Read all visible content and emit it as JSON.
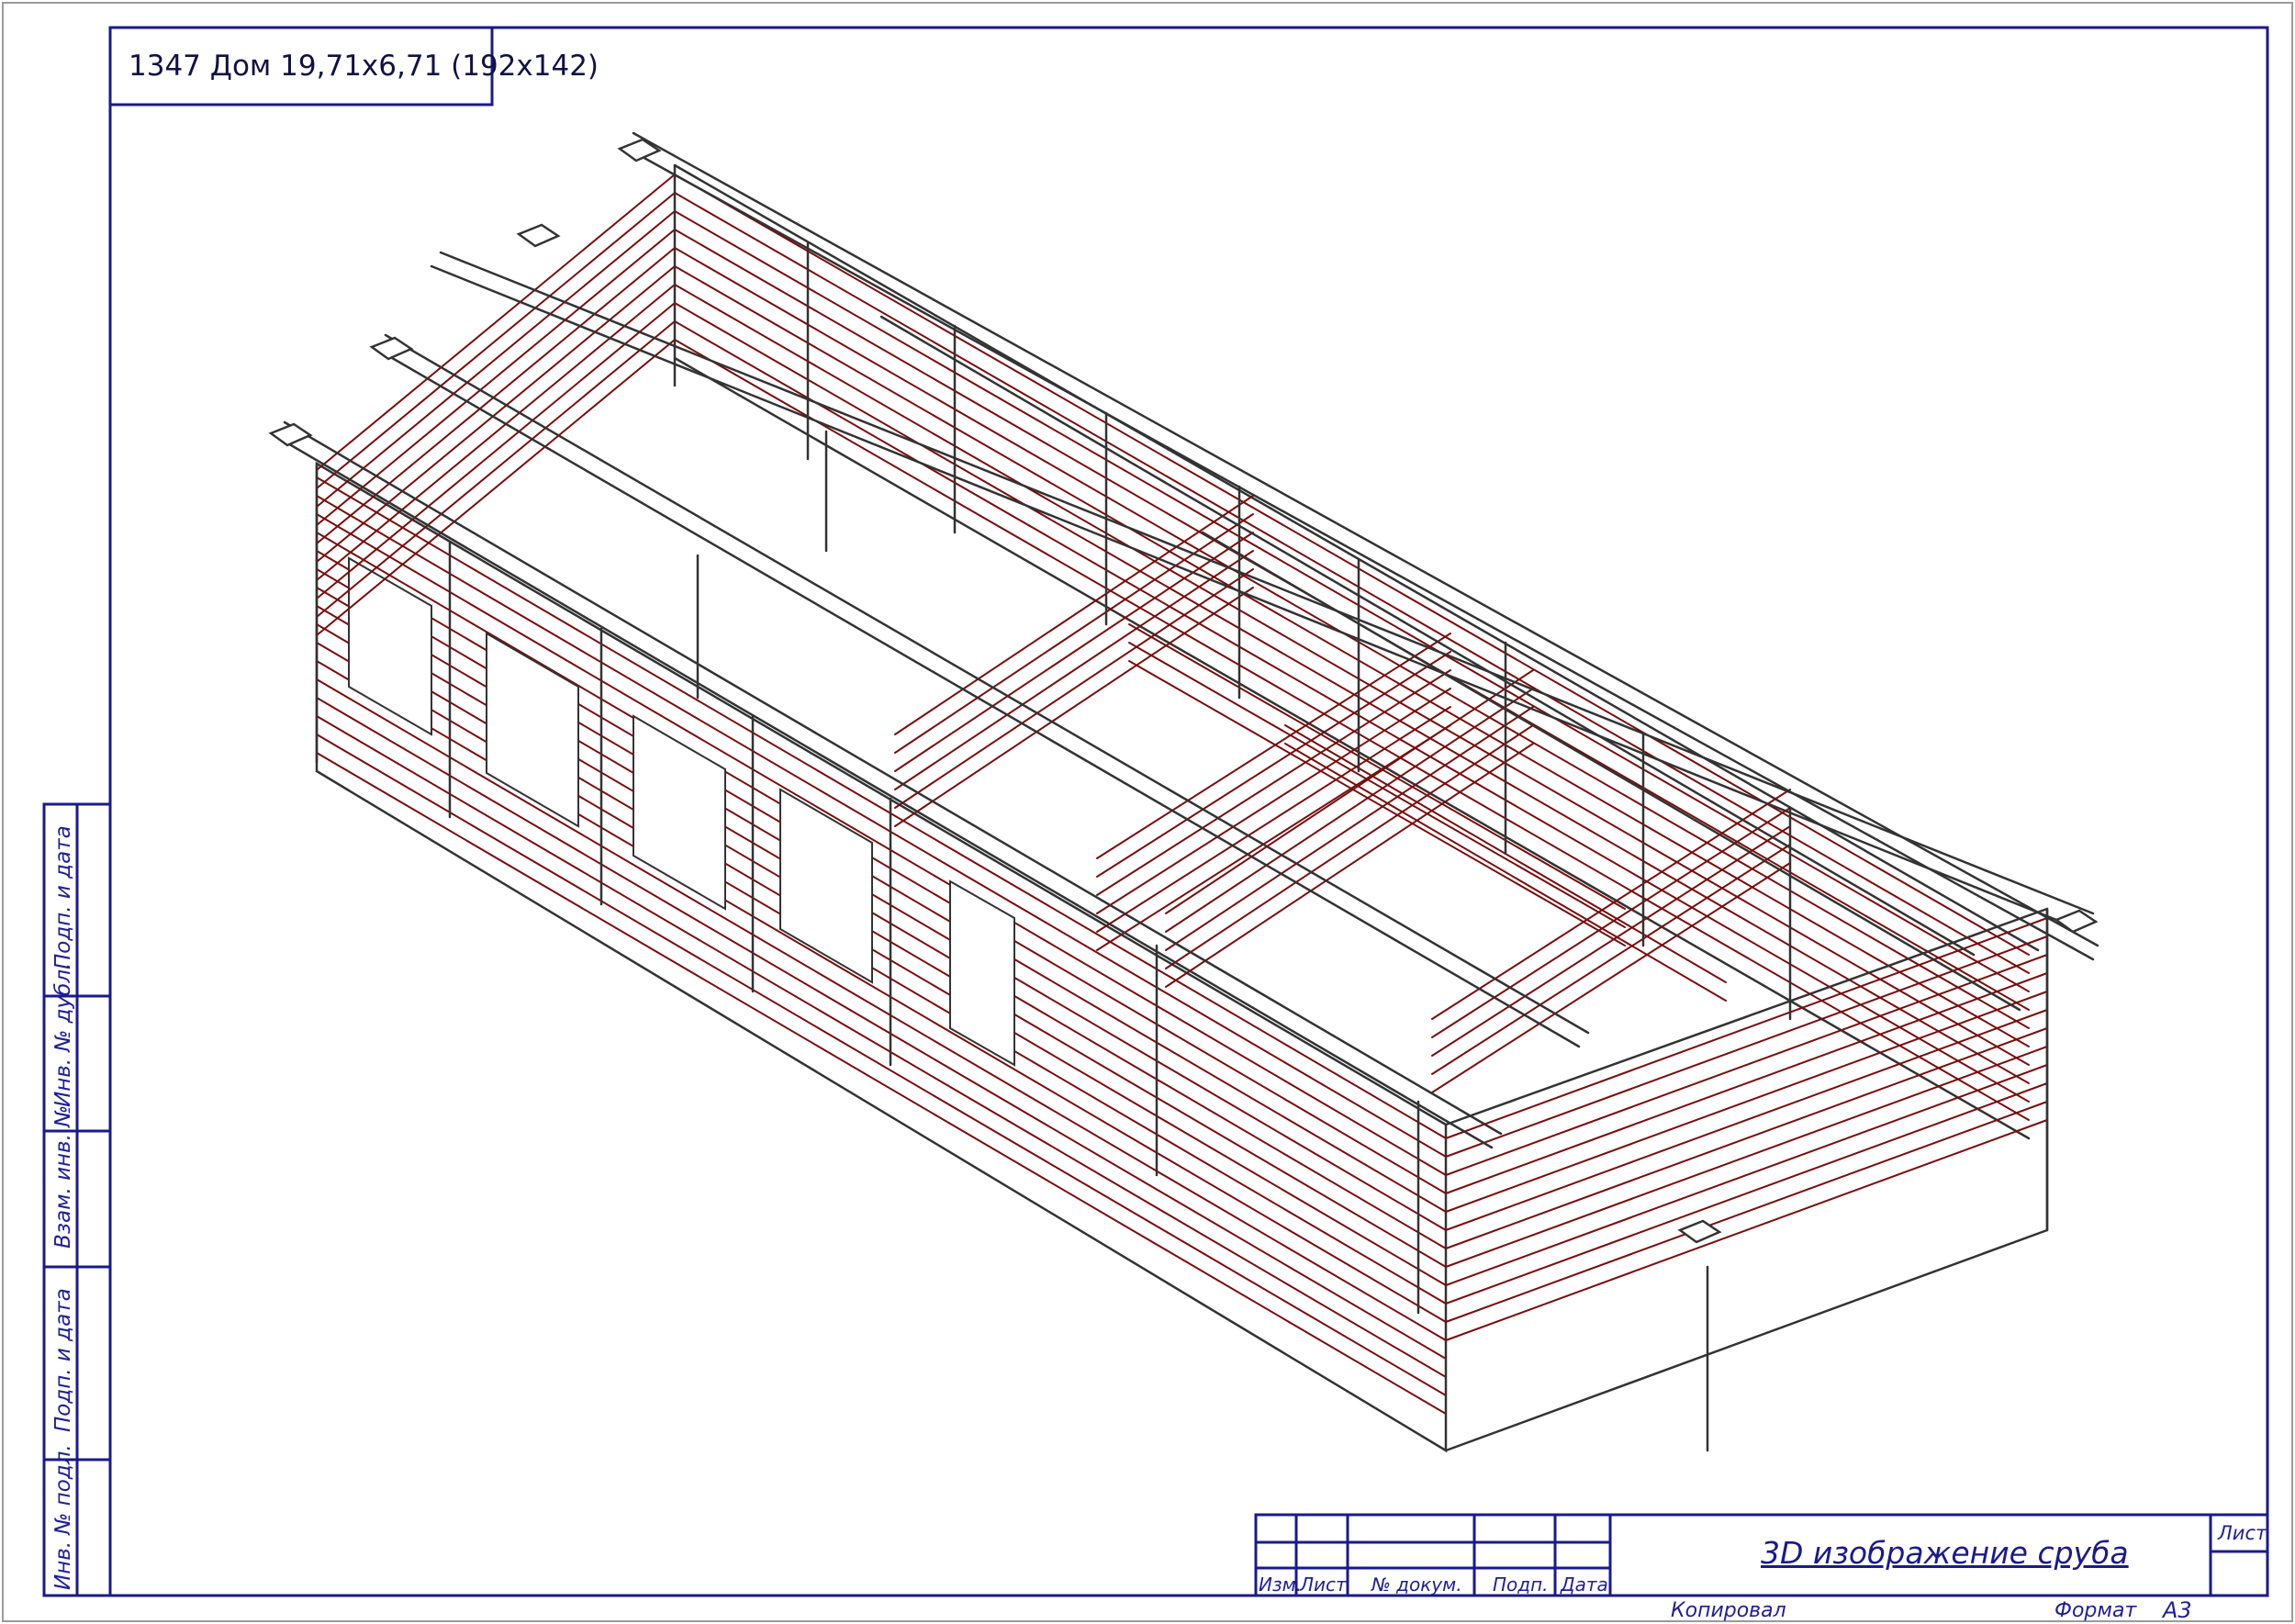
{
  "drawing": {
    "title": "1347 Дом 19,71х6,71 (192х142)"
  },
  "side_stamp": {
    "labels": [
      "Подп. и дата",
      "Инв. № дубл.",
      "Взам. инв. №",
      "Подп. и дата",
      "Инв. № подл."
    ]
  },
  "title_block": {
    "main_title": "3D изображение сруба",
    "sheet_label": "Лист",
    "headers": [
      "Изм.",
      "Лист",
      "№ докум.",
      "Подп.",
      "Дата"
    ],
    "copied_label": "Копировал",
    "format_label": "Формат",
    "format_value": "А3"
  },
  "colors": {
    "frame": "#1a1a8c",
    "model_lines": "#7a0d0d",
    "background": "#ffffff"
  }
}
